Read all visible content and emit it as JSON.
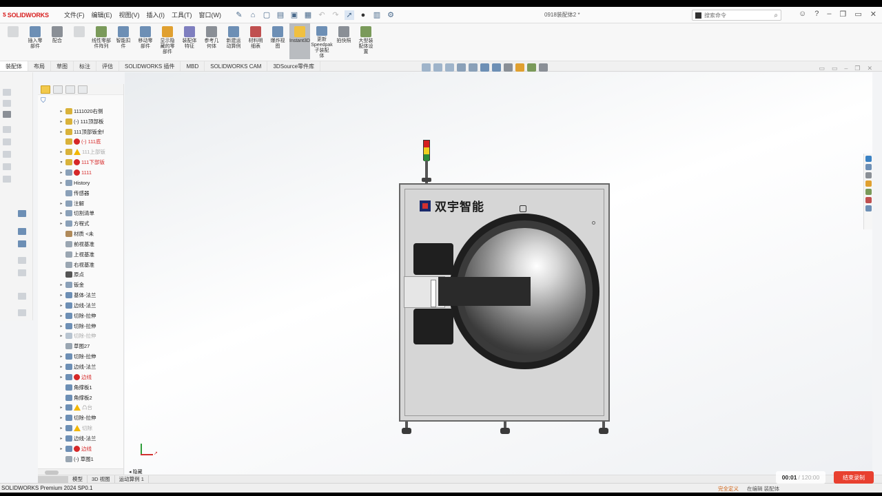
{
  "app": {
    "logo": "SOLIDWORKS",
    "document_title": "0918装配体2 *",
    "product": "SOLIDWORKS Premium 2024 SP0.1"
  },
  "menu": [
    "文件(F)",
    "编辑(E)",
    "视图(V)",
    "插入(I)",
    "工具(T)",
    "窗口(W)"
  ],
  "search": {
    "placeholder": "搜索命令"
  },
  "ribbon": [
    {
      "label": "",
      "dim": true,
      "color": "#9aa0a6"
    },
    {
      "label": "插入零\n部件",
      "dim": false,
      "color": "#6d8fb5"
    },
    {
      "label": "配合",
      "dim": false,
      "color": "#8a8f96"
    },
    {
      "label": "",
      "dim": true,
      "color": "#9aa0a6"
    },
    {
      "label": "线性零部\n件阵列",
      "dim": false,
      "color": "#7a9a5a"
    },
    {
      "label": "智能扣\n件",
      "dim": false,
      "color": "#6d8fb5"
    },
    {
      "label": "移动零\n部件",
      "dim": false,
      "color": "#6d8fb5"
    },
    {
      "label": "显示隐\n藏的零\n部件",
      "dim": false,
      "color": "#e0a030"
    },
    {
      "label": "装配体\n特征",
      "dim": false,
      "color": "#7f7fbf"
    },
    {
      "label": "参考几\n何体",
      "dim": false,
      "color": "#8a8f96"
    },
    {
      "label": "新建运\n动算例",
      "dim": false,
      "color": "#6d8fb5"
    },
    {
      "label": "材料明\n细表",
      "dim": false,
      "color": "#c05050"
    },
    {
      "label": "爆炸视\n图",
      "dim": false,
      "color": "#6d8fb5"
    },
    {
      "label": "Instant3D",
      "dim": false,
      "color": "#f0c040",
      "active": true
    },
    {
      "label": "更新\nSpeedpak\n子装配\n体",
      "dim": false,
      "color": "#6d8fb5"
    },
    {
      "label": "拍快照",
      "dim": false,
      "color": "#8a8f96"
    },
    {
      "label": "大型装\n配体设\n置",
      "dim": false,
      "color": "#7a9a5a"
    }
  ],
  "command_tabs": [
    "装配体",
    "布局",
    "草图",
    "标注",
    "评估",
    "SOLIDWORKS 插件",
    "MBD",
    "SOLIDWORKS CAM",
    "3DSource零件库"
  ],
  "active_command_tab": 0,
  "tree": [
    {
      "arrow": "▸",
      "icon": "#d9b23a",
      "status": "",
      "label": "1111020右侧",
      "style": ""
    },
    {
      "arrow": "▸",
      "icon": "#d9b23a",
      "status": "",
      "label": "(-) 111顶部板",
      "style": ""
    },
    {
      "arrow": "▸",
      "icon": "#d9b23a",
      "status": "",
      "label": "111顶部钣金f",
      "style": ""
    },
    {
      "arrow": "",
      "icon": "#d9b23a",
      "status": "bad",
      "label": "(-) 111底",
      "style": "red"
    },
    {
      "arrow": "▸",
      "icon": "#d9b23a",
      "status": "warn",
      "label": "111上部钣",
      "style": "grey"
    },
    {
      "arrow": "▾",
      "icon": "#d9b23a",
      "status": "bad",
      "label": "111下部钣",
      "style": "red"
    },
    {
      "arrow": "▸",
      "icon": "#8aa0b8",
      "status": "bad",
      "label": "1111",
      "style": "red"
    },
    {
      "arrow": "▸",
      "icon": "#8aa0b8",
      "status": "",
      "label": "History",
      "style": ""
    },
    {
      "arrow": "",
      "icon": "#8aa0b8",
      "status": "",
      "label": "传感器",
      "style": ""
    },
    {
      "arrow": "▸",
      "icon": "#8aa0b8",
      "status": "",
      "label": "注解",
      "style": ""
    },
    {
      "arrow": "▸",
      "icon": "#8aa0b8",
      "status": "",
      "label": "切割清单",
      "style": ""
    },
    {
      "arrow": "▸",
      "icon": "#8aa0b8",
      "status": "",
      "label": "方程式",
      "style": ""
    },
    {
      "arrow": "",
      "icon": "#b08a5a",
      "status": "",
      "label": "材质 <未",
      "style": ""
    },
    {
      "arrow": "",
      "icon": "#9aa6b2",
      "status": "",
      "label": "前视基准",
      "style": ""
    },
    {
      "arrow": "",
      "icon": "#9aa6b2",
      "status": "",
      "label": "上视基准",
      "style": ""
    },
    {
      "arrow": "",
      "icon": "#9aa6b2",
      "status": "",
      "label": "右视基准",
      "style": ""
    },
    {
      "arrow": "",
      "icon": "#555555",
      "status": "",
      "label": "原点",
      "style": ""
    },
    {
      "arrow": "▸",
      "icon": "#8aa0b8",
      "status": "",
      "label": "钣金",
      "style": ""
    },
    {
      "arrow": "▸",
      "icon": "#6d8fb5",
      "status": "",
      "label": "基体-法兰",
      "style": ""
    },
    {
      "arrow": "▸",
      "icon": "#6d8fb5",
      "status": "",
      "label": "边线-法兰",
      "style": ""
    },
    {
      "arrow": "▸",
      "icon": "#6d8fb5",
      "status": "",
      "label": "切除-拉伸",
      "style": ""
    },
    {
      "arrow": "▸",
      "icon": "#6d8fb5",
      "status": "",
      "label": "切除-拉伸",
      "style": ""
    },
    {
      "arrow": "▸",
      "icon": "#b8c4d0",
      "status": "",
      "label": "切除-拉伸",
      "style": "grey"
    },
    {
      "arrow": "",
      "icon": "#9aa6b2",
      "status": "",
      "label": "草图27",
      "style": ""
    },
    {
      "arrow": "▸",
      "icon": "#6d8fb5",
      "status": "",
      "label": "切除-拉伸",
      "style": ""
    },
    {
      "arrow": "▸",
      "icon": "#6d8fb5",
      "status": "",
      "label": "边线-法兰",
      "style": ""
    },
    {
      "arrow": "▸",
      "icon": "#6d8fb5",
      "status": "bad",
      "label": "边线",
      "style": "red"
    },
    {
      "arrow": "",
      "icon": "#6d8fb5",
      "status": "",
      "label": "角撑板1",
      "style": ""
    },
    {
      "arrow": "",
      "icon": "#6d8fb5",
      "status": "",
      "label": "角撑板2",
      "style": ""
    },
    {
      "arrow": "▸",
      "icon": "#6d8fb5",
      "status": "warn",
      "label": "凸台",
      "style": "grey"
    },
    {
      "arrow": "▸",
      "icon": "#6d8fb5",
      "status": "",
      "label": "切除-拉伸",
      "style": ""
    },
    {
      "arrow": "▸",
      "icon": "#6d8fb5",
      "status": "warn",
      "label": "切除",
      "style": "grey"
    },
    {
      "arrow": "▸",
      "icon": "#6d8fb5",
      "status": "",
      "label": "边线-法兰",
      "style": ""
    },
    {
      "arrow": "▸",
      "icon": "#6d8fb5",
      "status": "bad",
      "label": "边线",
      "style": "red"
    },
    {
      "arrow": "",
      "icon": "#9aa6b2",
      "status": "",
      "label": "(-) 草图1",
      "style": ""
    }
  ],
  "model": {
    "brand_text": "双宇智能"
  },
  "bottom_tabs": [
    "模型",
    "3D 视图",
    "运动算例 1"
  ],
  "collapse_label": "◂ 隐藏",
  "status": {
    "fully_defined": "完全定义",
    "workspace": "在编辑 装配体"
  },
  "recording": {
    "current": "00:01",
    "total": "120:00",
    "button": "结束录制"
  }
}
